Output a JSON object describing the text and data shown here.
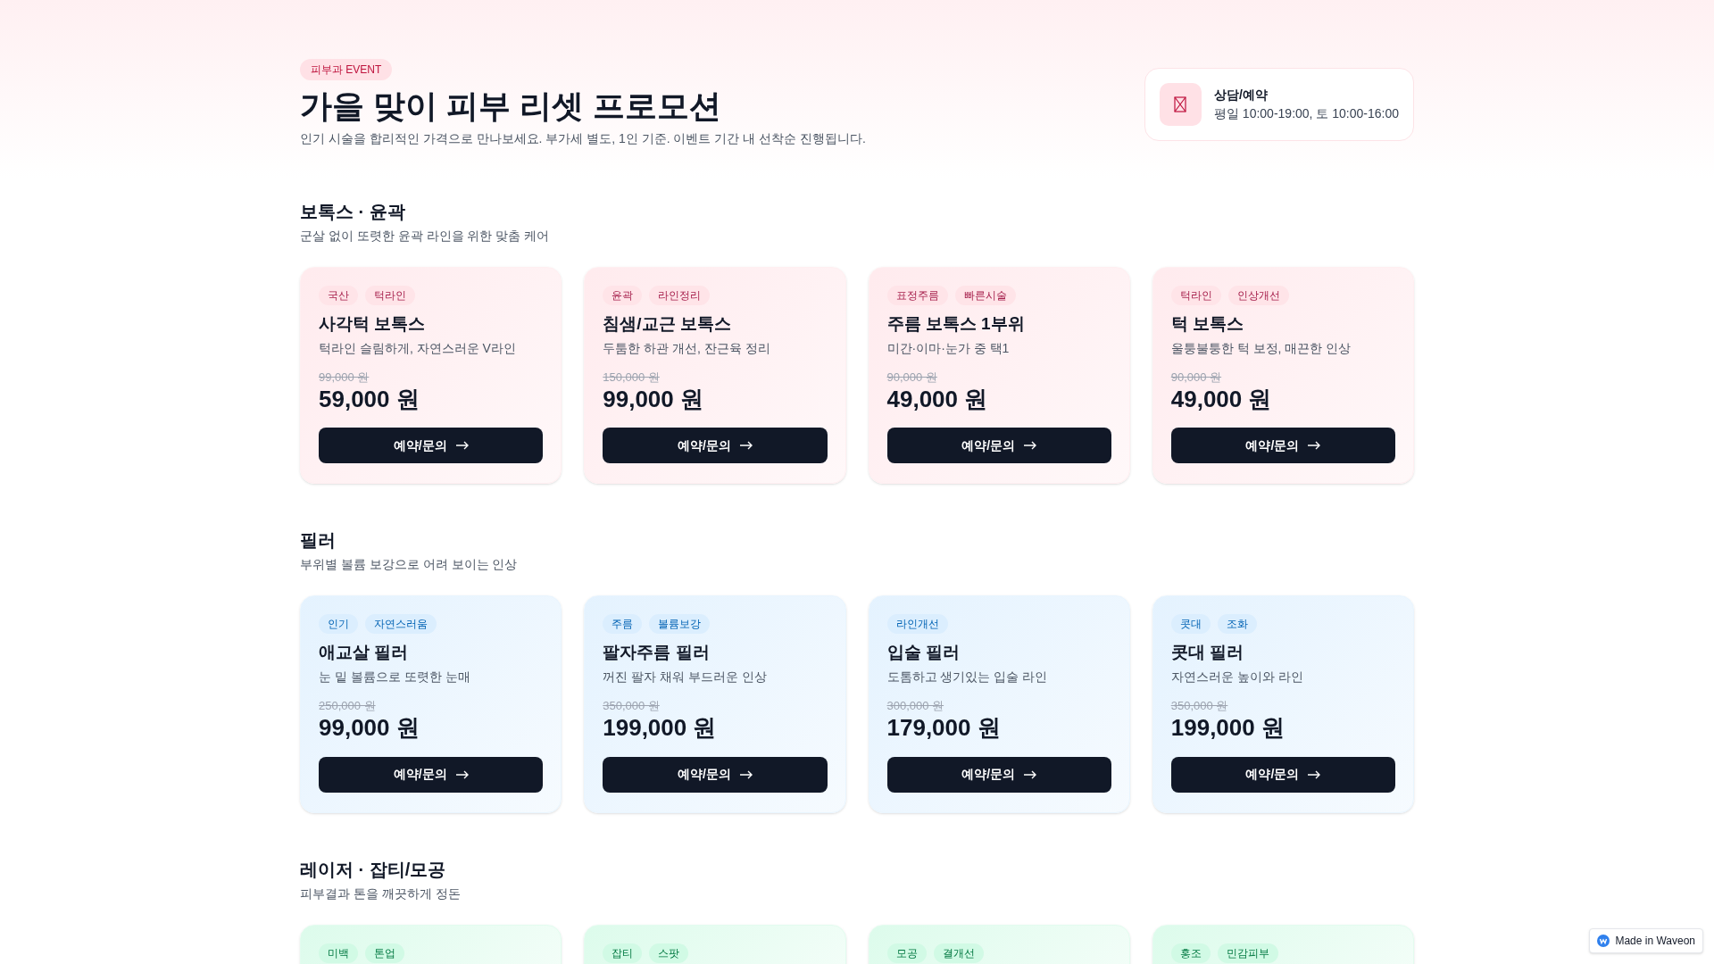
{
  "header": {
    "badge": "피부과 EVENT",
    "title": "가을 맞이 피부 리셋 프로모션",
    "subtitle": "인기 시술을 합리적인 가격으로 만나보세요. 부가세 별도, 1인 기준. 이벤트 기간 내 선착순 진행됩니다."
  },
  "contact": {
    "title": "상담/예약",
    "hours": "평일 10:00-19:00, 토 10:00-16:00"
  },
  "sections": [
    {
      "title": "보톡스 · 윤곽",
      "subtitle": "군살 없이 또렷한 윤곽 라인을 위한 맞춤 케어",
      "color": "#ffe4e8",
      "cards": [
        {
          "tags": [
            "국산",
            "턱라인"
          ],
          "name": "사각턱 보톡스",
          "desc": "턱라인 슬림하게, 자연스러운 V라인",
          "old_price": "99,000 원",
          "price": "59,000 원",
          "button": "예약/문의"
        },
        {
          "tags": [
            "윤곽",
            "라인정리"
          ],
          "name": "침샘/교근 보톡스",
          "desc": "두툼한 하관 개선, 잔근육 정리",
          "old_price": "150,000 원",
          "price": "99,000 원",
          "button": "예약/문의"
        },
        {
          "tags": [
            "표정주름",
            "빠른시술"
          ],
          "name": "주름 보톡스 1부위",
          "desc": "미간·이마·눈가 중 택1",
          "old_price": "90,000 원",
          "price": "49,000 원",
          "button": "예약/문의"
        },
        {
          "tags": [
            "턱라인",
            "인상개선"
          ],
          "name": "턱 보톡스",
          "desc": "울퉁불퉁한 턱 보정, 매끈한 인상",
          "old_price": "90,000 원",
          "price": "49,000 원",
          "button": "예약/문의"
        }
      ]
    },
    {
      "title": "필러",
      "subtitle": "부위별 볼륨 보강으로 어려 보이는 인상",
      "color": "#dbeefe",
      "cards": [
        {
          "tags": [
            "인기",
            "자연스러움"
          ],
          "name": "애교살 필러",
          "desc": "눈 밑 볼륨으로 또렷한 눈매",
          "old_price": "250,000 원",
          "price": "99,000 원",
          "button": "예약/문의"
        },
        {
          "tags": [
            "주름",
            "볼륨보강"
          ],
          "name": "팔자주름 필러",
          "desc": "꺼진 팔자 채워 부드러운 인상",
          "old_price": "350,000 원",
          "price": "199,000 원",
          "button": "예약/문의"
        },
        {
          "tags": [
            "라인개선"
          ],
          "name": "입술 필러",
          "desc": "도톰하고 생기있는 입술 라인",
          "old_price": "300,000 원",
          "price": "179,000 원",
          "button": "예약/문의"
        },
        {
          "tags": [
            "콧대",
            "조화"
          ],
          "name": "콧대 필러",
          "desc": "자연스러운 높이와 라인",
          "old_price": "350,000 원",
          "price": "199,000 원",
          "button": "예약/문의"
        }
      ]
    },
    {
      "title": "레이저 · 잡티/모공",
      "subtitle": "피부결과 톤을 깨끗하게 정돈",
      "color": "#d1fae5",
      "cards": [
        {
          "tags": [
            "미백",
            "톤업"
          ]
        },
        {
          "tags": [
            "잡티",
            "스팟"
          ]
        },
        {
          "tags": [
            "모공",
            "결개선"
          ]
        },
        {
          "tags": [
            "홍조",
            "민감피부"
          ]
        }
      ]
    }
  ],
  "made_in": "Made in Waveon"
}
